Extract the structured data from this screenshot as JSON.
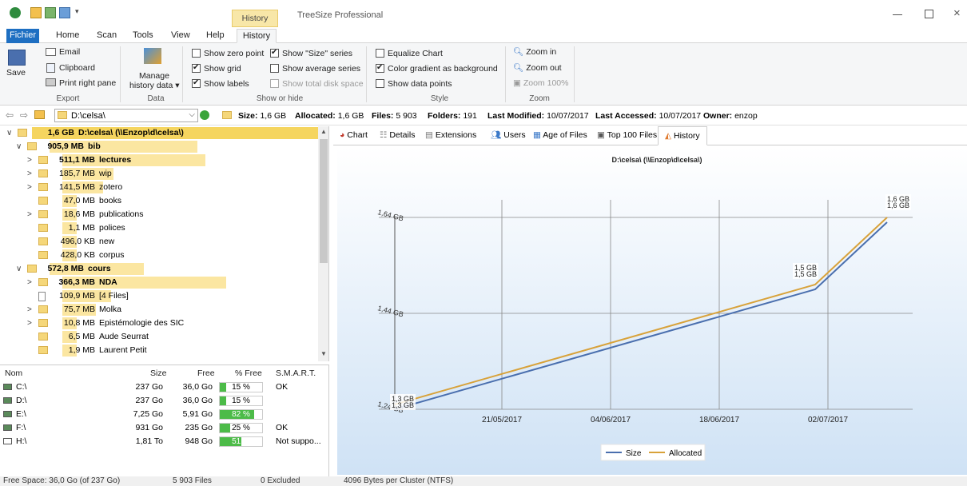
{
  "window": {
    "context_tab": "History Tools",
    "app_title": "TreeSize Professional"
  },
  "menu_tabs": [
    "Fichier",
    "Home",
    "Scan",
    "Tools",
    "View",
    "Help",
    "History"
  ],
  "ribbon": {
    "export": {
      "save": "Save",
      "email": "Email",
      "clipboard": "Clipboard",
      "print": "Print right pane",
      "group": "Export"
    },
    "data": {
      "manage": "Manage",
      "manage2": "history data ▾",
      "group": "Data"
    },
    "show": {
      "zero": "Show zero point",
      "size_series": "Show \"Size\" series",
      "grid": "Show grid",
      "avg": "Show average series",
      "labels": "Show labels",
      "total": "Show total disk space",
      "group": "Show or hide"
    },
    "style": {
      "equalize": "Equalize Chart",
      "gradient": "Color gradient as background",
      "points": "Show data points",
      "group": "Style"
    },
    "zoom": {
      "in": "Zoom in",
      "out": "Zoom out",
      "hundred": "Zoom 100%",
      "group": "Zoom"
    }
  },
  "address": {
    "path": "D:\\celsa\\",
    "size_label": "Size:",
    "size": "1,6 GB",
    "alloc_label": "Allocated:",
    "alloc": "1,6 GB",
    "files_label": "Files:",
    "files": "5 903",
    "folders_label": "Folders:",
    "folders": "191",
    "modified_label": "Last Modified:",
    "modified": "10/07/2017",
    "accessed_label": "Last Accessed:",
    "accessed": "10/07/2017",
    "owner_label": "Owner:",
    "owner": "enzop"
  },
  "tree": [
    {
      "size": "1,6 GB",
      "name": "D:\\celsa\\  (\\\\Enzop\\d\\celsa\\)",
      "bold": true,
      "fill": 1.0
    },
    {
      "size": "905,9 MB",
      "name": "bib",
      "bold": true,
      "fill": 0.55
    },
    {
      "size": "511,1 MB",
      "name": "lectures",
      "bold": true,
      "fill": 0.56
    },
    {
      "size": "185,7 MB",
      "name": "wip",
      "bold": false,
      "fill": 0.2
    },
    {
      "size": "141,5 MB",
      "name": "zotero",
      "bold": false,
      "fill": 0.16
    },
    {
      "size": "47,0 MB",
      "name": "books",
      "bold": false,
      "fill": 0.05
    },
    {
      "size": "18,6 MB",
      "name": "publications",
      "bold": false,
      "fill": 0.02
    },
    {
      "size": "1,1 MB",
      "name": "polices",
      "bold": false,
      "fill": 0.0
    },
    {
      "size": "496,0 KB",
      "name": "new",
      "bold": false,
      "fill": 0.0
    },
    {
      "size": "428,0 KB",
      "name": "corpus",
      "bold": false,
      "fill": 0.0
    },
    {
      "size": "572,8 MB",
      "name": "cours",
      "bold": true,
      "fill": 0.35
    },
    {
      "size": "366,3 MB",
      "name": "NDA",
      "bold": true,
      "fill": 0.64
    },
    {
      "size": "109,9 MB",
      "name": "[4 Files]",
      "bold": false,
      "fill": 0.19
    },
    {
      "size": "75,7 MB",
      "name": "Molka",
      "bold": false,
      "fill": 0.13
    },
    {
      "size": "10,8 MB",
      "name": "Epistémologie des SIC",
      "bold": false,
      "fill": 0.02
    },
    {
      "size": "6,5 MB",
      "name": "Aude Seurrat",
      "bold": false,
      "fill": 0.01
    },
    {
      "size": "1,9 MB",
      "name": "Laurent Petit",
      "bold": false,
      "fill": 0.0
    }
  ],
  "drives": {
    "headers": [
      "Nom",
      "Size",
      "Free",
      "% Free",
      "S.M.A.R.T."
    ],
    "rows": [
      {
        "name": "C:\\",
        "size": "237 Go",
        "free": "36,0 Go",
        "pct": "15 %",
        "pct_value": 15,
        "smart": "OK"
      },
      {
        "name": "D:\\",
        "size": "237 Go",
        "free": "36,0 Go",
        "pct": "15 %",
        "pct_value": 15,
        "smart": ""
      },
      {
        "name": "E:\\",
        "size": "7,25 Go",
        "free": "5,91 Go",
        "pct": "82 %",
        "pct_value": 82,
        "smart": ""
      },
      {
        "name": "F:\\",
        "size": "931 Go",
        "free": "235 Go",
        "pct": "25 %",
        "pct_value": 25,
        "smart": "OK"
      },
      {
        "name": "H:\\",
        "size": "1,81 To",
        "free": "948 Go",
        "pct": "51 %",
        "pct_value": 51,
        "smart": "Not suppo..."
      }
    ]
  },
  "status": {
    "free": "Free Space: 36,0 Go  (of 237 Go)",
    "files": "5 903  Files",
    "excluded": "0 Excluded",
    "cluster": "4096  Bytes per Cluster (NTFS)"
  },
  "right_tabs": [
    "Chart",
    "Details",
    "Extensions",
    "Users",
    "Age of Files",
    "Top 100 Files",
    "History"
  ],
  "chart_data": {
    "type": "line",
    "title": "D:\\celsa\\  (\\\\Enzop\\d\\celsa\\)",
    "y_ticks": [
      "1,64 GB",
      "1,44 GB",
      "1,24 GB"
    ],
    "y_tick_values": [
      1.64,
      1.44,
      1.24
    ],
    "x_ticks": [
      "21/05/2017",
      "04/06/2017",
      "18/06/2017",
      "02/07/2017"
    ],
    "ylim": [
      1.24,
      1.64
    ],
    "series": [
      {
        "name": "Size",
        "color": "#4a6fae",
        "values": [
          1.24,
          1.49,
          1.63
        ]
      },
      {
        "name": "Allocated",
        "color": "#d8a23a",
        "values": [
          1.25,
          1.5,
          1.64
        ]
      }
    ],
    "x_dates": [
      "07/05/2017",
      "02/07/2017",
      "10/07/2017"
    ],
    "labels": [
      "1,3 GB",
      "1,5 GB",
      "1,6 GB"
    ],
    "grid": true,
    "legend": "bottom"
  }
}
